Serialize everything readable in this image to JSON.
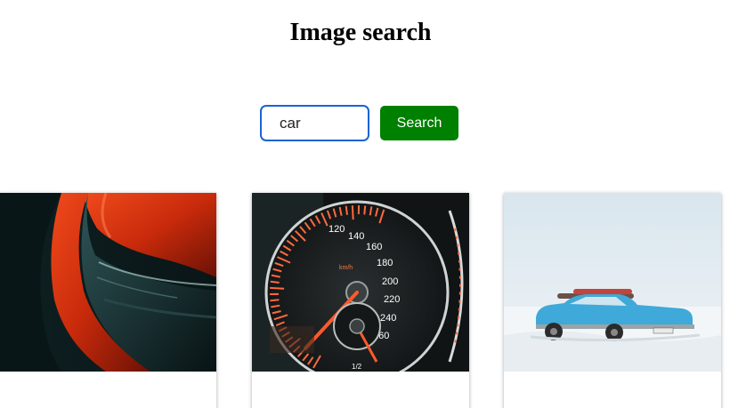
{
  "page": {
    "title": "Image search"
  },
  "search": {
    "value": "car",
    "button_label": "Search"
  },
  "results": [
    {
      "subject": "red sports car headlight close-up"
    },
    {
      "subject": "car speedometer gauge",
      "gauge_labels": [
        "120",
        "140",
        "160",
        "180",
        "200",
        "220",
        "240",
        "260",
        "km/h",
        "1/2"
      ]
    },
    {
      "subject": "blue vintage car with roof rack on snowy field"
    }
  ]
}
